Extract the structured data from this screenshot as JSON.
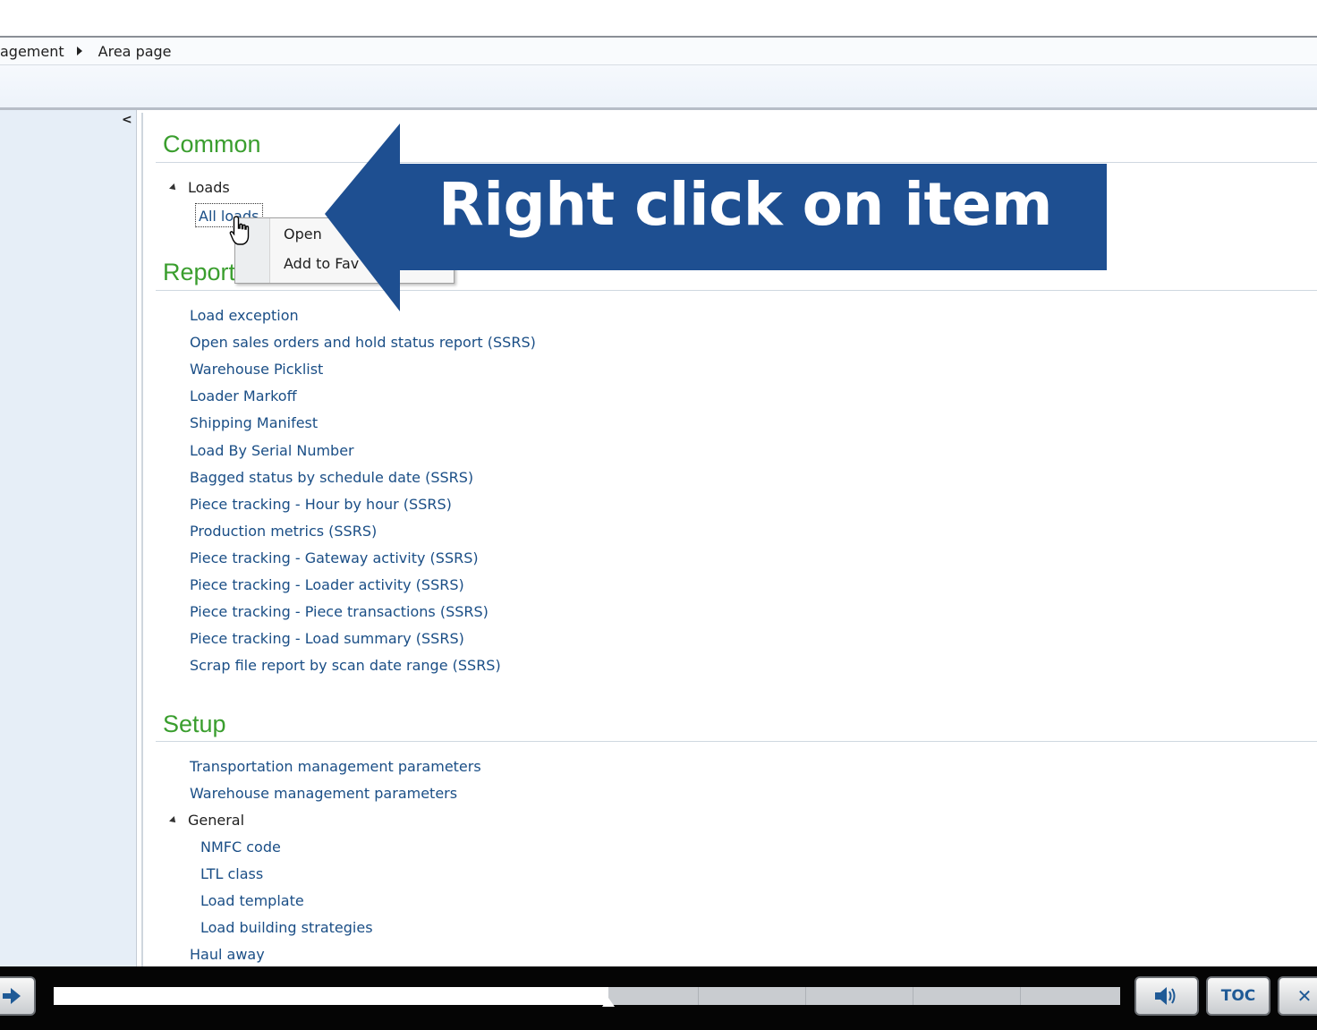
{
  "breadcrumb": {
    "items": [
      "agement",
      "Area page"
    ]
  },
  "sections": {
    "common": {
      "title": "Common",
      "group": "Loads",
      "selected_item": "All loads"
    },
    "reports": {
      "title": "Reports",
      "items": [
        "Load exception",
        "Open sales orders and hold status report (SSRS)",
        "Warehouse Picklist",
        "Loader Markoff",
        "Shipping Manifest",
        "Load By Serial Number",
        "Bagged status by schedule date (SSRS)",
        "Piece tracking - Hour by hour (SSRS)",
        "Production metrics (SSRS)",
        "Piece tracking - Gateway activity (SSRS)",
        "Piece tracking - Loader activity (SSRS)",
        "Piece tracking - Piece transactions (SSRS)",
        "Piece tracking - Load summary (SSRS)",
        "Scrap file report by scan date range (SSRS)"
      ]
    },
    "setup": {
      "title": "Setup",
      "items": [
        "Transportation management parameters",
        "Warehouse management parameters"
      ],
      "group": "General",
      "group_items": [
        "NMFC code",
        "LTL class",
        "Load template",
        "Load building strategies"
      ],
      "trailing_item": "Haul away"
    }
  },
  "context_menu": {
    "open": "Open",
    "add_to_favorites": "Add to Fav"
  },
  "callout": {
    "text": "Right click on item",
    "color": "#1e4f91"
  },
  "player": {
    "progress": 0.52,
    "volume_icon": "speaker-icon",
    "toc_label": "TOC",
    "close_label": "✕"
  },
  "colors": {
    "section_title": "#3a9e2e",
    "link": "#1a4e86"
  }
}
